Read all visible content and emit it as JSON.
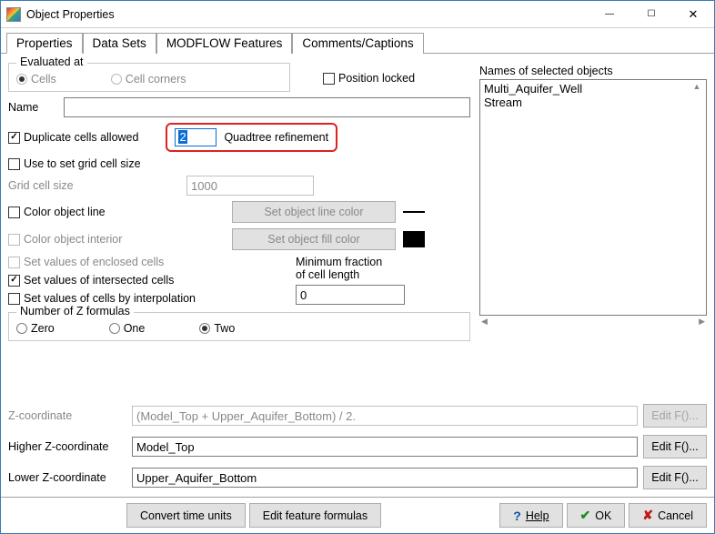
{
  "window": {
    "title": "Object Properties"
  },
  "tabs": {
    "items": [
      {
        "label": "Properties",
        "active": true
      },
      {
        "label": "Data Sets",
        "active": false
      },
      {
        "label": "MODFLOW Features",
        "active": false
      },
      {
        "label": "Comments/Captions",
        "active": false
      }
    ]
  },
  "evaluated_at": {
    "legend": "Evaluated at",
    "cells": "Cells",
    "cell_corners": "Cell corners"
  },
  "position_locked": "Position locked",
  "name_label": "Name",
  "name_value": "",
  "duplicate_cells_allowed": "Duplicate cells allowed",
  "quadtree": {
    "value": "2",
    "label": "Quadtree refinement"
  },
  "use_grid_cell_size": "Use to set grid cell size",
  "grid_cell_size_label": "Grid cell size",
  "grid_cell_size_value": "1000",
  "color_object_line": "Color object line",
  "set_line_color_btn": "Set object line color",
  "color_object_interior": "Color object interior",
  "set_fill_color_btn": "Set object fill color",
  "set_enclosed": "Set values of enclosed cells",
  "set_intersected": "Set values of intersected cells",
  "set_interp": "Set values of cells by interpolation",
  "min_fraction_label1": "Minimum fraction",
  "min_fraction_label2": "of cell length",
  "min_fraction_value": "0",
  "z_formulas": {
    "legend": "Number of Z formulas",
    "zero": "Zero",
    "one": "One",
    "two": "Two"
  },
  "zcoord": {
    "z_label": "Z-coordinate",
    "z_value": "(Model_Top + Upper_Aquifer_Bottom) / 2.",
    "higher_label": "Higher Z-coordinate",
    "higher_value": "Model_Top",
    "lower_label": "Lower Z-coordinate",
    "lower_value": "Upper_Aquifer_Bottom",
    "editf": "Edit F()..."
  },
  "selected_objects": {
    "label": "Names of selected objects",
    "items": [
      "Multi_Aquifer_Well",
      "Stream"
    ]
  },
  "footer": {
    "convert_time": "Convert time units",
    "edit_feature": "Edit feature formulas",
    "help": "Help",
    "ok": "OK",
    "cancel": "Cancel"
  }
}
